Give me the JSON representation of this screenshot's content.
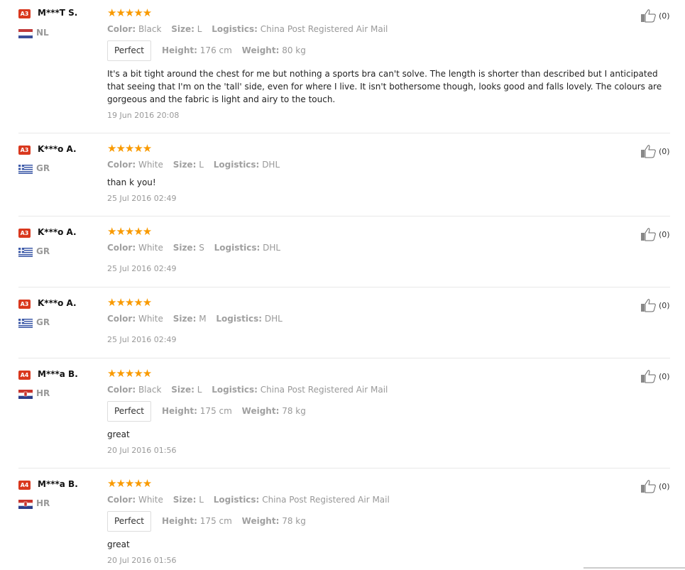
{
  "reviews": [
    {
      "badge": "A3",
      "badge_color": "#d9381e",
      "name": "M***T S.",
      "country": "NL",
      "flag": "nl",
      "stars": "★★★★★",
      "meta": [
        {
          "label": "Color:",
          "value": "Black"
        },
        {
          "label": "Size:",
          "value": "L"
        },
        {
          "label": "Logistics:",
          "value": "China Post Registered Air Mail"
        }
      ],
      "rating": "Perfect",
      "height_label": "Height:",
      "height": "176 cm",
      "weight_label": "Weight:",
      "weight": "80 kg",
      "text": "It's a bit tight around the chest for me but nothing a sports bra can't solve. The length is shorter than described but I anticipated that seeing that I'm on the 'tall' side, even for where I live. It isn't bothersome though, looks good and falls lovely. The colours are gorgeous and the fabric is light and airy to the touch.",
      "date": "19 Jun 2016 20:08",
      "helpful": "(0)"
    },
    {
      "badge": "A3",
      "badge_color": "#d9381e",
      "name": "K***o A.",
      "country": "GR",
      "flag": "gr",
      "stars": "★★★★★",
      "meta": [
        {
          "label": "Color:",
          "value": "White"
        },
        {
          "label": "Size:",
          "value": "L"
        },
        {
          "label": "Logistics:",
          "value": "DHL"
        }
      ],
      "text": "than k you!",
      "date": "25 Jul 2016 02:49",
      "helpful": "(0)"
    },
    {
      "badge": "A3",
      "badge_color": "#d9381e",
      "name": "K***o A.",
      "country": "GR",
      "flag": "gr",
      "stars": "★★★★★",
      "meta": [
        {
          "label": "Color:",
          "value": "White"
        },
        {
          "label": "Size:",
          "value": "S"
        },
        {
          "label": "Logistics:",
          "value": "DHL"
        }
      ],
      "date": "25 Jul 2016 02:49",
      "helpful": "(0)"
    },
    {
      "badge": "A3",
      "badge_color": "#d9381e",
      "name": "K***o A.",
      "country": "GR",
      "flag": "gr",
      "stars": "★★★★★",
      "meta": [
        {
          "label": "Color:",
          "value": "White"
        },
        {
          "label": "Size:",
          "value": "M"
        },
        {
          "label": "Logistics:",
          "value": "DHL"
        }
      ],
      "date": "25 Jul 2016 02:49",
      "helpful": "(0)"
    },
    {
      "badge": "A4",
      "badge_color": "#d9381e",
      "name": "M***a B.",
      "country": "HR",
      "flag": "hr",
      "stars": "★★★★★",
      "meta": [
        {
          "label": "Color:",
          "value": "Black"
        },
        {
          "label": "Size:",
          "value": "L"
        },
        {
          "label": "Logistics:",
          "value": "China Post Registered Air Mail"
        }
      ],
      "rating": "Perfect",
      "height_label": "Height:",
      "height": "175 cm",
      "weight_label": "Weight:",
      "weight": "78 kg",
      "text": "great",
      "date": "20 Jul 2016 01:56",
      "helpful": "(0)"
    },
    {
      "badge": "A4",
      "badge_color": "#d9381e",
      "name": "M***a B.",
      "country": "HR",
      "flag": "hr",
      "stars": "★★★★★",
      "meta": [
        {
          "label": "Color:",
          "value": "White"
        },
        {
          "label": "Size:",
          "value": "L"
        },
        {
          "label": "Logistics:",
          "value": "China Post Registered Air Mail"
        }
      ],
      "rating": "Perfect",
      "height_label": "Height:",
      "height": "175 cm",
      "weight_label": "Weight:",
      "weight": "78 kg",
      "text": "great",
      "date": "20 Jul 2016 01:56",
      "helpful": "(0)"
    }
  ]
}
